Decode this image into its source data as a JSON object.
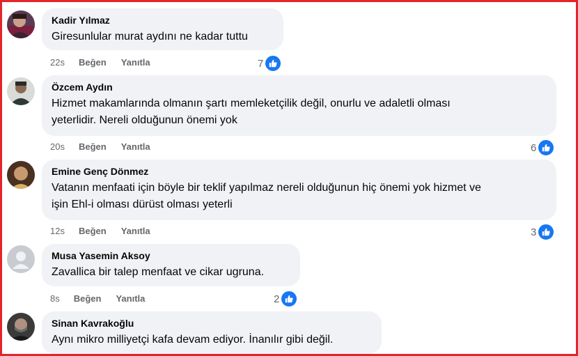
{
  "comments": [
    {
      "author": "Kadir Yılmaz",
      "text_lines": [
        "Giresunlular murat aydını ne kadar tuttu"
      ],
      "time": "22s",
      "like_label": "Beğen",
      "reply_label": "Yanıtla",
      "reaction_count": "7",
      "reaction_icon": "thumbs-up-icon"
    },
    {
      "author": "Özcem Aydın",
      "text_lines": [
        "Hizmet makamlarında olmanın şartı memleketçilik değil, onurlu ve adaletli olması",
        "yeterlidir. Nereli olduğunun önemi yok"
      ],
      "time": "20s",
      "like_label": "Beğen",
      "reply_label": "Yanıtla",
      "reaction_count": "6",
      "reaction_icon": "thumbs-up-icon"
    },
    {
      "author": "Emine Genç Dönmez",
      "text_lines": [
        "Vatanın menfaati için böyle bir teklif yapılmaz nereli olduğunun hiç önemi yok hizmet ve",
        "işin Ehl-i olması dürüst olması yeterli"
      ],
      "time": "12s",
      "like_label": "Beğen",
      "reply_label": "Yanıtla",
      "reaction_count": "3",
      "reaction_icon": "thumbs-up-icon"
    },
    {
      "author": "Musa Yasemin Aksoy",
      "text_lines": [
        "Zavallica bir talep menfaat ve cikar ugruna."
      ],
      "time": "8s",
      "like_label": "Beğen",
      "reply_label": "Yanıtla",
      "reaction_count": "2",
      "reaction_icon": "thumbs-up-icon"
    },
    {
      "author": "Sinan Kavrakoğlu",
      "text_lines": [
        "Aynı mikro milliyetçi kafa devam ediyor. İnanılır gibi değil."
      ]
    }
  ],
  "colors": {
    "bubble_bg": "#f0f2f5",
    "like_blue": "#1877f2",
    "meta_gray": "#65676b",
    "frame_red": "#e3242b"
  }
}
